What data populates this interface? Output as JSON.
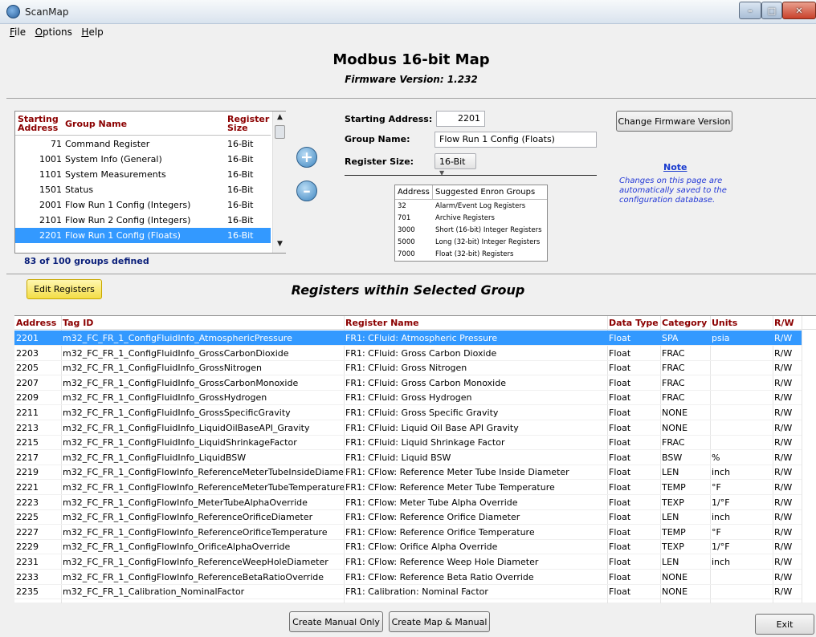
{
  "window": {
    "title": "ScanMap"
  },
  "menu": [
    {
      "label": "File",
      "accel": "F",
      "rest": "ile"
    },
    {
      "label": "Options",
      "accel": "O",
      "rest": "ptions"
    },
    {
      "label": "Help",
      "accel": "H",
      "rest": "elp"
    }
  ],
  "header": {
    "title": "Modbus 16-bit Map",
    "firmware": "Firmware Version: 1.232"
  },
  "group_list": {
    "col_address": "Starting Address",
    "col_address_1": "Starting",
    "col_address_2": "Address",
    "col_name": "Group Name",
    "col_size_1": "Register",
    "col_size_2": "Size",
    "rows": [
      {
        "address": "71",
        "name": "Command Register",
        "size": "16-Bit",
        "selected": false
      },
      {
        "address": "1001",
        "name": "System Info (General)",
        "size": "16-Bit",
        "selected": false
      },
      {
        "address": "1101",
        "name": "System Measurements",
        "size": "16-Bit",
        "selected": false
      },
      {
        "address": "1501",
        "name": "Status",
        "size": "16-Bit",
        "selected": false
      },
      {
        "address": "2001",
        "name": "Flow Run 1 Config (Integers)",
        "size": "16-Bit",
        "selected": false
      },
      {
        "address": "2101",
        "name": "Flow Run 2 Config (Integers)",
        "size": "16-Bit",
        "selected": false
      },
      {
        "address": "2201",
        "name": "Flow Run 1 Config (Floats)",
        "size": "16-Bit",
        "selected": true
      }
    ],
    "groups_defined": "83 of 100 groups defined"
  },
  "form": {
    "start_label": "Starting Address:",
    "start_value": "2201",
    "name_label": "Group Name:",
    "name_value": "Flow Run 1 Config (Floats)",
    "size_label": "Register Size:",
    "size_value": "16-Bit"
  },
  "enron": {
    "col_address": "Address",
    "col_groups": "Suggested Enron Groups",
    "rows": [
      {
        "address": "32",
        "group": "Alarm/Event Log Registers"
      },
      {
        "address": "701",
        "group": "Archive Registers"
      },
      {
        "address": "3000",
        "group": "Short (16-bit) Integer Registers"
      },
      {
        "address": "5000",
        "group": "Long (32-bit) Integer Registers"
      },
      {
        "address": "7000",
        "group": "Float (32-bit) Registers"
      }
    ]
  },
  "change_fw_label": "Change Firmware Version",
  "note": {
    "title": "Note",
    "text": "Changes on this page are automatically saved to the configuration database."
  },
  "edit_registers_label": "Edit Registers",
  "registers_title": "Registers within Selected Group",
  "registers": {
    "columns": {
      "address": "Address",
      "tag": "Tag ID",
      "name": "Register Name",
      "type": "Data Type",
      "category": "Category",
      "units": "Units",
      "rw": "R/W"
    },
    "rows": [
      {
        "address": "2201",
        "tag": "m32_FC_FR_1_ConfigFluidInfo_AtmosphericPressure",
        "name": "FR1: CFluid: Atmospheric Pressure",
        "type": "Float",
        "category": "SPA",
        "units": "psia",
        "rw": "R/W",
        "selected": true
      },
      {
        "address": "2203",
        "tag": "m32_FC_FR_1_ConfigFluidInfo_GrossCarbonDioxide",
        "name": "FR1: CFluid: Gross Carbon Dioxide",
        "type": "Float",
        "category": "FRAC",
        "units": "",
        "rw": "R/W",
        "selected": false
      },
      {
        "address": "2205",
        "tag": "m32_FC_FR_1_ConfigFluidInfo_GrossNitrogen",
        "name": "FR1: CFluid: Gross Nitrogen",
        "type": "Float",
        "category": "FRAC",
        "units": "",
        "rw": "R/W",
        "selected": false
      },
      {
        "address": "2207",
        "tag": "m32_FC_FR_1_ConfigFluidInfo_GrossCarbonMonoxide",
        "name": "FR1: CFluid: Gross Carbon Monoxide",
        "type": "Float",
        "category": "FRAC",
        "units": "",
        "rw": "R/W",
        "selected": false
      },
      {
        "address": "2209",
        "tag": "m32_FC_FR_1_ConfigFluidInfo_GrossHydrogen",
        "name": "FR1: CFluid: Gross Hydrogen",
        "type": "Float",
        "category": "FRAC",
        "units": "",
        "rw": "R/W",
        "selected": false
      },
      {
        "address": "2211",
        "tag": "m32_FC_FR_1_ConfigFluidInfo_GrossSpecificGravity",
        "name": "FR1: CFluid: Gross Specific Gravity",
        "type": "Float",
        "category": "NONE",
        "units": "",
        "rw": "R/W",
        "selected": false
      },
      {
        "address": "2213",
        "tag": "m32_FC_FR_1_ConfigFluidInfo_LiquidOilBaseAPI_Gravity",
        "name": "FR1: CFluid: Liquid Oil Base API Gravity",
        "type": "Float",
        "category": "NONE",
        "units": "",
        "rw": "R/W",
        "selected": false
      },
      {
        "address": "2215",
        "tag": "m32_FC_FR_1_ConfigFluidInfo_LiquidShrinkageFactor",
        "name": "FR1: CFluid: Liquid Shrinkage Factor",
        "type": "Float",
        "category": "FRAC",
        "units": "",
        "rw": "R/W",
        "selected": false
      },
      {
        "address": "2217",
        "tag": "m32_FC_FR_1_ConfigFluidInfo_LiquidBSW",
        "name": "FR1: CFluid: Liquid BSW",
        "type": "Float",
        "category": "BSW",
        "units": "%",
        "rw": "R/W",
        "selected": false
      },
      {
        "address": "2219",
        "tag": "m32_FC_FR_1_ConfigFlowInfo_ReferenceMeterTubeInsideDiameter",
        "name": "FR1: CFlow: Reference Meter Tube Inside Diameter",
        "type": "Float",
        "category": "LEN",
        "units": "inch",
        "rw": "R/W",
        "selected": false
      },
      {
        "address": "2221",
        "tag": "m32_FC_FR_1_ConfigFlowInfo_ReferenceMeterTubeTemperature",
        "name": "FR1: CFlow: Reference Meter Tube Temperature",
        "type": "Float",
        "category": "TEMP",
        "units": "°F",
        "rw": "R/W",
        "selected": false
      },
      {
        "address": "2223",
        "tag": "m32_FC_FR_1_ConfigFlowInfo_MeterTubeAlphaOverride",
        "name": "FR1: CFlow: Meter Tube Alpha Override",
        "type": "Float",
        "category": "TEXP",
        "units": "1/°F",
        "rw": "R/W",
        "selected": false
      },
      {
        "address": "2225",
        "tag": "m32_FC_FR_1_ConfigFlowInfo_ReferenceOrificeDiameter",
        "name": "FR1: CFlow: Reference Orifice Diameter",
        "type": "Float",
        "category": "LEN",
        "units": "inch",
        "rw": "R/W",
        "selected": false
      },
      {
        "address": "2227",
        "tag": "m32_FC_FR_1_ConfigFlowInfo_ReferenceOrificeTemperature",
        "name": "FR1: CFlow: Reference Orifice Temperature",
        "type": "Float",
        "category": "TEMP",
        "units": "°F",
        "rw": "R/W",
        "selected": false
      },
      {
        "address": "2229",
        "tag": "m32_FC_FR_1_ConfigFlowInfo_OrificeAlphaOverride",
        "name": "FR1: CFlow: Orifice Alpha Override",
        "type": "Float",
        "category": "TEXP",
        "units": "1/°F",
        "rw": "R/W",
        "selected": false
      },
      {
        "address": "2231",
        "tag": "m32_FC_FR_1_ConfigFlowInfo_ReferenceWeepHoleDiameter",
        "name": "FR1: CFlow: Reference Weep Hole Diameter",
        "type": "Float",
        "category": "LEN",
        "units": "inch",
        "rw": "R/W",
        "selected": false
      },
      {
        "address": "2233",
        "tag": "m32_FC_FR_1_ConfigFlowInfo_ReferenceBetaRatioOverride",
        "name": "FR1: CFlow: Reference Beta Ratio Override",
        "type": "Float",
        "category": "NONE",
        "units": "",
        "rw": "R/W",
        "selected": false
      },
      {
        "address": "2235",
        "tag": "m32_FC_FR_1_Calibration_NominalFactor",
        "name": "FR1: Calibration: Nominal Factor",
        "type": "Float",
        "category": "NONE",
        "units": "",
        "rw": "R/W",
        "selected": false
      }
    ]
  },
  "buttons": {
    "create_manual": "Create Manual Only",
    "create_map": "Create Map & Manual",
    "exit": "Exit"
  },
  "colors": {
    "selection": "#3399ff",
    "header_text": "#8b0000",
    "note_text": "#2338d6"
  }
}
